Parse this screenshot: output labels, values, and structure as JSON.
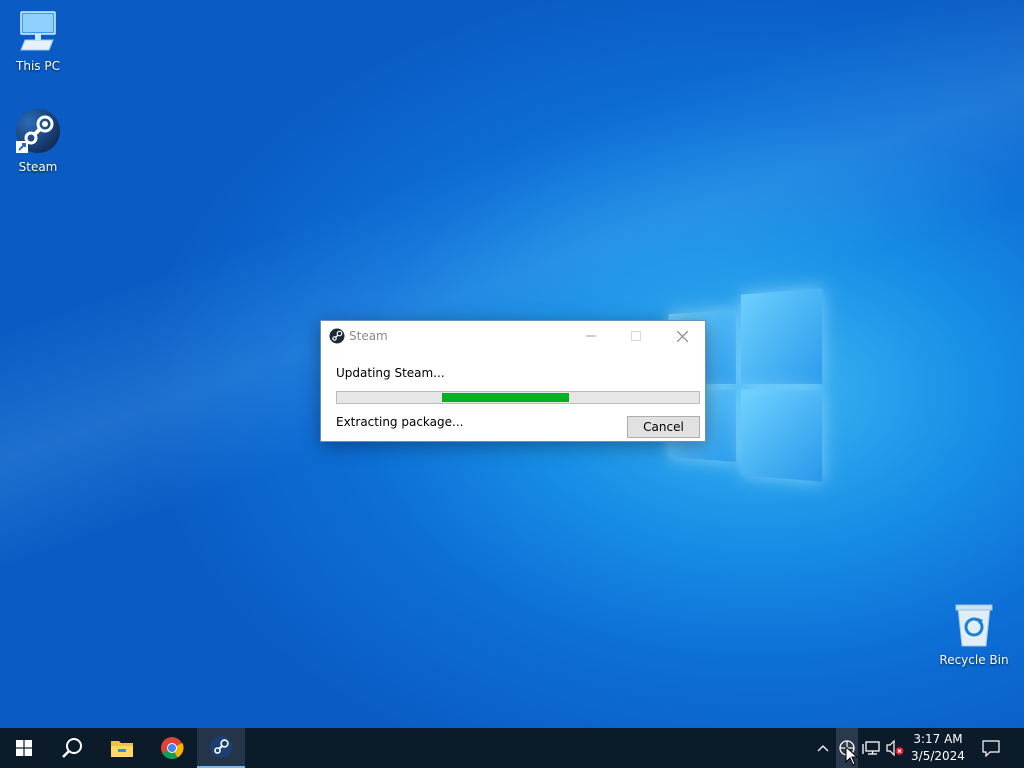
{
  "desktop": {
    "icons": [
      {
        "label": "This PC"
      },
      {
        "label": "Steam"
      },
      {
        "label": "Recycle Bin"
      }
    ]
  },
  "dialog": {
    "title": "Steam",
    "status": "Updating Steam...",
    "substatus": "Extracting package...",
    "cancel_label": "Cancel",
    "progress": {
      "start_fraction": 0.29,
      "end_fraction": 0.64,
      "color": "#06b025"
    }
  },
  "taskbar": {
    "apps": [
      "start-icon",
      "search-icon",
      "file-explorer-icon",
      "chrome-icon",
      "steam-icon"
    ],
    "clock": {
      "time": "3:17 AM",
      "date": "3/5/2024"
    }
  },
  "colors": {
    "taskbar_bg": "#0c1b2a",
    "accent": "#0078d7"
  }
}
